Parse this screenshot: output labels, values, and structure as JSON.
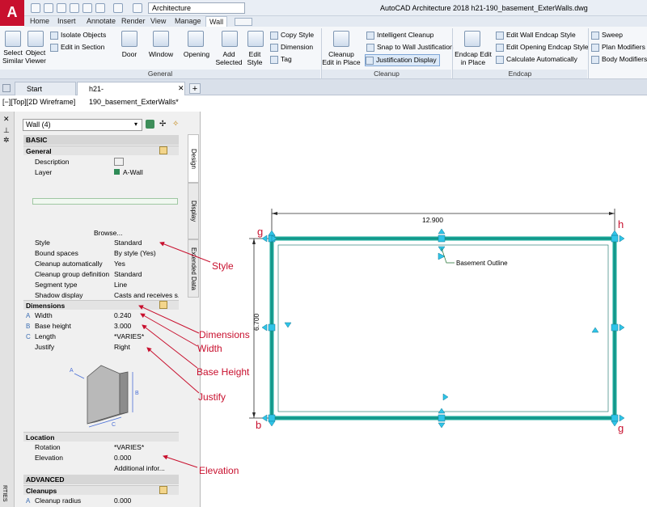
{
  "titlebar": {
    "app_logo": "A",
    "workspace": "Architecture",
    "title": "AutoCAD Architecture 2018    h21-190_basement_ExterWalls.dwg"
  },
  "tabs": [
    "Home",
    "Insert",
    "Annotate",
    "Render",
    "View",
    "Manage",
    "Wall"
  ],
  "ribbon": {
    "general": {
      "title": "General",
      "select_similar": "Select Similar",
      "object_viewer": "Object Viewer",
      "isolate_objects": "Isolate Objects",
      "edit_in_section": "Edit in Section",
      "door": "Door",
      "window": "Window",
      "opening": "Opening",
      "add_selected": "Add Selected",
      "edit_style": "Edit Style",
      "copy_style": "Copy Style",
      "dimension": "Dimension",
      "tag": "Tag"
    },
    "cleanup": {
      "title": "Cleanup",
      "cleanup_edit_in_place": "Cleanup Edit in Place",
      "intelligent_cleanup": "Intelligent Cleanup",
      "snap_to_wall_justification": "Snap to Wall Justification",
      "justification_display": "Justification Display"
    },
    "endcap": {
      "title": "Endcap",
      "endcap_edit_in_place": "Endcap Edit in Place",
      "edit_wall_endcap_style": "Edit Wall Endcap Style",
      "edit_opening_endcap_style": "Edit Opening Endcap Style",
      "calculate_automatically": "Calculate Automatically"
    },
    "modify": {
      "sweep": "Sweep",
      "plan_modifiers": "Plan Modifiers",
      "body_modifiers": "Body Modifiers"
    }
  },
  "doc_tabs": [
    "Start",
    "h21-190_basement_ExterWalls*"
  ],
  "view_label": "[−][Top][2D Wireframe]",
  "palette": {
    "selection": "Wall (4)",
    "tabs": [
      "Design",
      "Display",
      "Extended Data"
    ],
    "basic": "BASIC",
    "general": "General",
    "description_label": "Description",
    "layer_label": "Layer",
    "layer_value": "A-Wall",
    "browse": "Browse...",
    "style_label": "Style",
    "style_value": "Standard",
    "bound_spaces_label": "Bound spaces",
    "bound_spaces_value": "By style (Yes)",
    "cleanup_auto_label": "Cleanup automatically",
    "cleanup_auto_value": "Yes",
    "cleanup_group_label": "Cleanup group definition",
    "cleanup_group_value": "Standard",
    "segment_type_label": "Segment type",
    "segment_type_value": "Line",
    "shadow_label": "Shadow display",
    "shadow_value": "Casts and receives s...",
    "dimensions": "Dimensions",
    "width_letter": "A",
    "width_label": "Width",
    "width_value": "0.240",
    "base_height_letter": "B",
    "base_height_label": "Base height",
    "base_height_value": "3.000",
    "length_letter": "C",
    "length_label": "Length",
    "length_value": "*VARIES*",
    "justify_label": "Justify",
    "justify_value": "Right",
    "location": "Location",
    "rotation_label": "Rotation",
    "rotation_value": "*VARIES*",
    "elevation_label": "Elevation",
    "elevation_value": "0.000",
    "additional_info": "Additional infor...",
    "advanced": "ADVANCED",
    "cleanups": "Cleanups",
    "cleanup_radius_letter": "A",
    "cleanup_radius_label": "Cleanup radius",
    "cleanup_radius_value": "0.000",
    "strip_label": "RTIES"
  },
  "annotations": {
    "style": "Style",
    "dimensions": "Dimensions",
    "width": "Width",
    "base_height": "Base Height",
    "justify": "Justify",
    "elevation": "Elevation"
  },
  "drawing": {
    "dim_horizontal": "12.900",
    "dim_vertical": "6.700",
    "label": "Basement Outline",
    "corner_g_top": "g",
    "corner_h": "h",
    "corner_b": "b",
    "corner_g_bottom": "g"
  },
  "colors": {
    "wall": "#19a89a",
    "grip": "#2fc4e8",
    "annotation": "#c8102e"
  }
}
